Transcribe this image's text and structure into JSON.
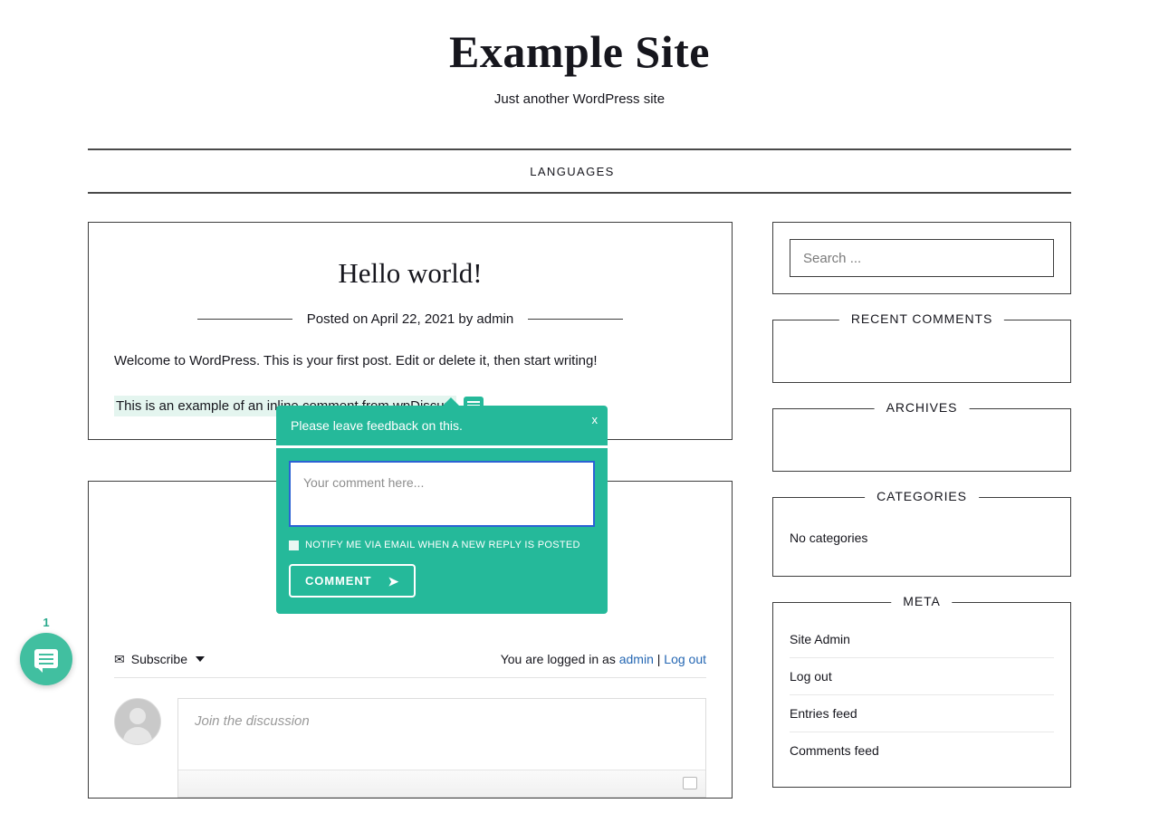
{
  "site": {
    "title": "Example Site",
    "description": "Just another WordPress site"
  },
  "nav": {
    "items": [
      {
        "label": "LANGUAGES"
      }
    ]
  },
  "post": {
    "title": "Hello world!",
    "meta": "Posted on April 22, 2021 by admin",
    "paragraph1": "Welcome to WordPress. This is your first post. Edit or delete it, then start writing!",
    "paragraph2_highlighted": "This is an example of an inline comment from wpDiscuz.",
    "inline_comment_icon": "comment-bubble-icon"
  },
  "inline_popup": {
    "heading": "Please leave feedback on this.",
    "close_label": "x",
    "textarea_placeholder": "Your comment here...",
    "textarea_value": "",
    "notify_label": "NOTIFY ME VIA EMAIL WHEN A NEW REPLY IS POSTED",
    "notify_checked": false,
    "submit_label": "COMMENT",
    "submit_icon": "send-arrow-icon",
    "accent_color": "#25b99a",
    "focus_border_color": "#2b62d4"
  },
  "subscribe_bar": {
    "subscribe_label": "Subscribe",
    "envelope_icon": "envelope-icon",
    "caret_icon": "chevron-down-icon",
    "logged_in_prefix": "You are logged in as ",
    "user": "admin",
    "separator": " | ",
    "logout_label": "Log out"
  },
  "comment_editor": {
    "avatar_icon": "user-avatar-icon",
    "placeholder": "Join the discussion",
    "value": ""
  },
  "sidebar": {
    "search": {
      "placeholder": "Search ...",
      "value": ""
    },
    "widgets": [
      {
        "title": "RECENT COMMENTS",
        "empty": true,
        "items": []
      },
      {
        "title": "ARCHIVES",
        "empty": true,
        "items": []
      },
      {
        "title": "CATEGORIES",
        "empty": false,
        "empty_text": "No categories",
        "items": []
      }
    ],
    "meta": {
      "title": "META",
      "items": [
        {
          "label": "Site Admin"
        },
        {
          "label": "Log out"
        },
        {
          "label": "Entries feed"
        },
        {
          "label": "Comments feed"
        }
      ]
    }
  },
  "floating_bubble": {
    "badge": "1",
    "icon": "comment-bubble-icon",
    "color": "#41bfa0"
  }
}
